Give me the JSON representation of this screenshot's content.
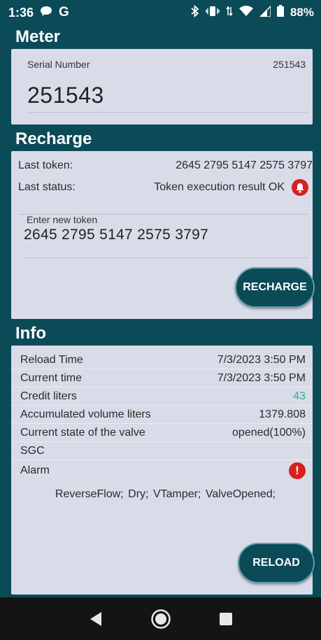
{
  "status_bar": {
    "time": "1:36",
    "g_label": "G",
    "battery_percent": "88%"
  },
  "meter": {
    "section_title": "Meter",
    "serial_label": "Serial Number",
    "serial_value_small": "251543",
    "serial_value_large": "251543"
  },
  "recharge": {
    "section_title": "Recharge",
    "last_token_label": "Last token:",
    "last_token_value": "2645 2795 5147 2575 3797",
    "last_status_label": "Last status:",
    "last_status_value": "Token execution result OK",
    "enter_token_label": "Enter new token",
    "new_token_value": "2645 2795 5147 2575 3797",
    "button_label": "RECHARGE"
  },
  "info": {
    "section_title": "Info",
    "rows": [
      {
        "label": "Reload Time",
        "value": "7/3/2023 3:50 PM"
      },
      {
        "label": "Current time",
        "value": "7/3/2023 3:50 PM"
      },
      {
        "label": "Credit liters",
        "value": "43"
      },
      {
        "label": "Accumulated volume liters",
        "value": "1379.808"
      },
      {
        "label": "Current state of the valve",
        "value": "opened(100%)"
      },
      {
        "label": "SGC",
        "value": ""
      }
    ],
    "alarm_label": "Alarm",
    "alarm_icon_text": "!",
    "alarm_list": "ReverseFlow;  Dry;  VTamper;  ValveOpened;",
    "button_label": "RELOAD"
  },
  "colors": {
    "app_bar": "#0b4a57",
    "card": "#d9dce8",
    "credit_green": "#1fba8c",
    "alert_red": "#d82020"
  },
  "icons": {
    "status_left": [
      "chat-bubble-icon",
      "google-g-icon"
    ],
    "status_right": [
      "bluetooth-icon",
      "vibrate-icon",
      "data-arrows-icon",
      "wifi-icon",
      "signal-icon",
      "battery-icon"
    ],
    "alert": "bell-icon",
    "alarm": "exclamation-icon",
    "nav": [
      "back-icon",
      "home-icon",
      "recents-icon"
    ]
  }
}
